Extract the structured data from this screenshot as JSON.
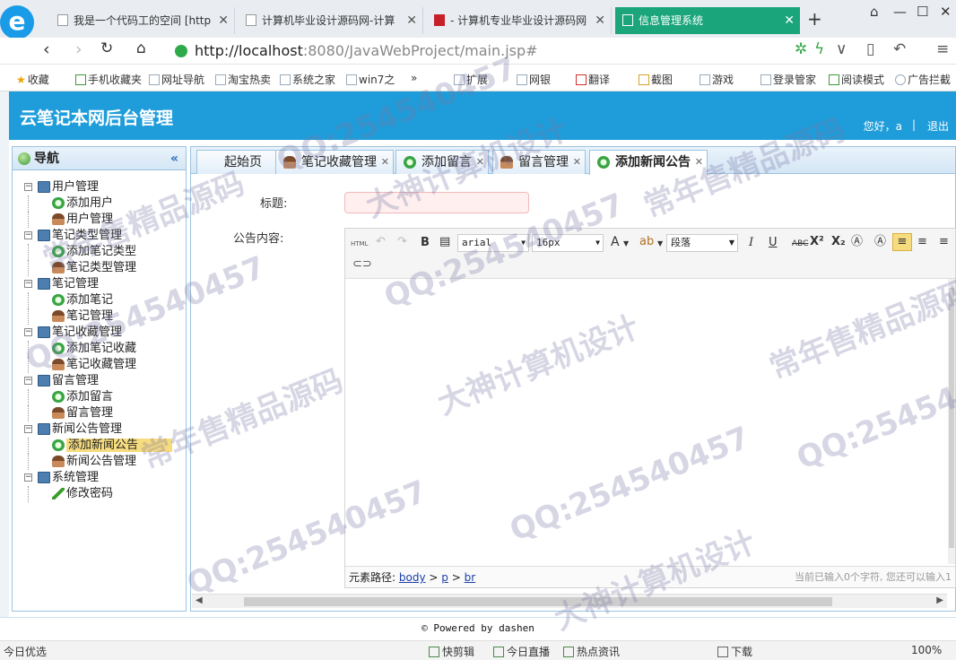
{
  "browser": {
    "tabs": [
      {
        "title": "我是一个代码工的空间 [http",
        "active": false
      },
      {
        "title": "计算机毕业设计源码网-计算",
        "active": false
      },
      {
        "title": "- 计算机专业毕业设计源码网",
        "active": false
      },
      {
        "title": "信息管理系统",
        "active": true
      }
    ],
    "new_tab": "+",
    "url_host": "http://localhost",
    "url_path": ":8080/JavaWebProject/main.jsp#",
    "bookmarks": [
      "收藏",
      "手机收藏夹",
      "网址导航",
      "淘宝热卖",
      "系统之家",
      "win7之",
      "»",
      "扩展",
      "网银",
      "翻译",
      "截图",
      "游戏",
      "登录管家",
      "阅读模式",
      "广告拦截"
    ],
    "accent": "#1aa57a"
  },
  "app": {
    "title": "云笔记本网后台管理",
    "greeting": "您好，a",
    "separator": "|",
    "logout": "退出",
    "header_color": "#1f9dda"
  },
  "sidebar": {
    "title": "导航",
    "collapse": "«",
    "groups": [
      {
        "label": "用户管理",
        "items": [
          {
            "label": "添加用户",
            "icon": "add-icon"
          },
          {
            "label": "用户管理",
            "icon": "user-icon"
          }
        ]
      },
      {
        "label": "笔记类型管理",
        "items": [
          {
            "label": "添加笔记类型",
            "icon": "add-icon"
          },
          {
            "label": "笔记类型管理",
            "icon": "user-icon"
          }
        ]
      },
      {
        "label": "笔记管理",
        "items": [
          {
            "label": "添加笔记",
            "icon": "add-icon"
          },
          {
            "label": "笔记管理",
            "icon": "user-icon"
          }
        ]
      },
      {
        "label": "笔记收藏管理",
        "items": [
          {
            "label": "添加笔记收藏",
            "icon": "add-icon"
          },
          {
            "label": "笔记收藏管理",
            "icon": "user-icon"
          }
        ]
      },
      {
        "label": "留言管理",
        "items": [
          {
            "label": "添加留言",
            "icon": "add-icon"
          },
          {
            "label": "留言管理",
            "icon": "user-icon"
          }
        ]
      },
      {
        "label": "新闻公告管理",
        "items": [
          {
            "label": "添加新闻公告",
            "icon": "add-icon",
            "selected": true
          },
          {
            "label": "新闻公告管理",
            "icon": "user-icon"
          }
        ]
      },
      {
        "label": "系统管理",
        "items": [
          {
            "label": "修改密码",
            "icon": "pencil-icon"
          }
        ]
      }
    ]
  },
  "tabs": [
    {
      "label": "起始页",
      "closable": false
    },
    {
      "label": "笔记收藏管理",
      "closable": true
    },
    {
      "label": "添加留言",
      "closable": true
    },
    {
      "label": "留言管理",
      "closable": true
    },
    {
      "label": "添加新闻公告",
      "closable": true,
      "active": true
    }
  ],
  "form": {
    "title_label": "标题:",
    "title_value": "",
    "content_label": "公告内容:"
  },
  "editor": {
    "toolbar": {
      "html": "HTML",
      "bold": "B",
      "font_family": "arial",
      "font_size": "16px",
      "font_color": "A",
      "paragraph": "段落",
      "italic": "I",
      "underline": "U",
      "strike": "ABC",
      "sup": "X²",
      "sub": "X₂"
    },
    "path_label": "元素路径:",
    "path": [
      "body",
      "p",
      "br"
    ],
    "path_sep": ">",
    "count_text": "当前已输入0个字符, 您还可以输入1"
  },
  "footer": "© Powered by dashen",
  "statusbar": {
    "left": "今日优选",
    "items": [
      "快剪辑",
      "今日直播",
      "热点资讯",
      "下载"
    ],
    "zoom": "100%"
  },
  "watermarks": [
    "QQ:254540457",
    "大神计算机设计",
    "常年售精品源码"
  ]
}
